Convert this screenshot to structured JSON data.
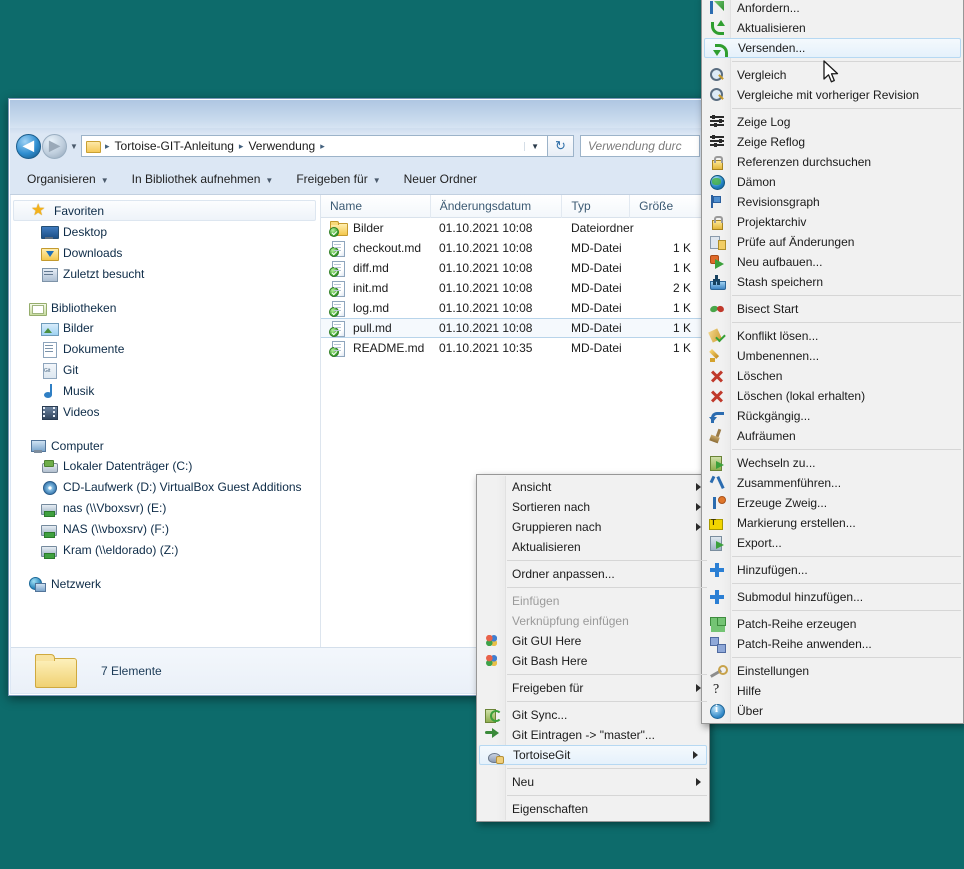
{
  "desktop": {
    "background_color": "#0d6b6b"
  },
  "explorer": {
    "address": {
      "breadcrumbs": [
        "Tortoise-GIT-Anleitung",
        "Verwendung"
      ],
      "separator": "▸",
      "back_label": "◀",
      "forward_label": "▶",
      "history_caret": "▼",
      "dropdown_caret": "▼",
      "refresh_label": "↻"
    },
    "search": {
      "placeholder": "Verwendung durc"
    },
    "toolbar": [
      {
        "label": "Organisieren",
        "has_caret": true
      },
      {
        "label": "In Bibliothek aufnehmen",
        "has_caret": true
      },
      {
        "label": "Freigeben für",
        "has_caret": true
      },
      {
        "label": "Neuer Ordner",
        "has_caret": false
      }
    ],
    "navpane": [
      {
        "label": "Favoriten",
        "icon": "star-icon",
        "type": "group",
        "selected": true
      },
      {
        "label": "Desktop",
        "icon": "desktop-icon",
        "type": "child"
      },
      {
        "label": "Downloads",
        "icon": "downloads-icon",
        "type": "child"
      },
      {
        "label": "Zuletzt besucht",
        "icon": "recent-icon",
        "type": "child"
      },
      {
        "label": "",
        "icon": "",
        "type": "spacer"
      },
      {
        "label": "Bibliotheken",
        "icon": "library-icon",
        "type": "group"
      },
      {
        "label": "Bilder",
        "icon": "pictures-icon",
        "type": "child"
      },
      {
        "label": "Dokumente",
        "icon": "documents-icon",
        "type": "child"
      },
      {
        "label": "Git",
        "icon": "git-library-icon",
        "type": "child"
      },
      {
        "label": "Musik",
        "icon": "music-icon",
        "type": "child"
      },
      {
        "label": "Videos",
        "icon": "video-icon",
        "type": "child"
      },
      {
        "label": "",
        "icon": "",
        "type": "spacer"
      },
      {
        "label": "Computer",
        "icon": "computer-icon",
        "type": "group"
      },
      {
        "label": "Lokaler Datenträger (C:)",
        "icon": "harddisk-icon",
        "type": "child"
      },
      {
        "label": "CD-Laufwerk (D:) VirtualBox Guest Additions",
        "icon": "cd-drive-icon",
        "type": "child"
      },
      {
        "label": "nas (\\\\Vboxsvr) (E:)",
        "icon": "network-drive-icon",
        "type": "child"
      },
      {
        "label": "NAS (\\\\vboxsrv) (F:)",
        "icon": "network-drive-icon",
        "type": "child"
      },
      {
        "label": "Kram (\\\\eldorado) (Z:)",
        "icon": "network-drive-icon",
        "type": "child"
      },
      {
        "label": "",
        "icon": "",
        "type": "spacer"
      },
      {
        "label": "Netzwerk",
        "icon": "network-icon",
        "type": "group"
      }
    ],
    "columns": [
      {
        "label": "Name",
        "sorted": true
      },
      {
        "label": "Änderungsdatum",
        "sorted": false
      },
      {
        "label": "Typ",
        "sorted": false
      },
      {
        "label": "Größe",
        "sorted": false
      }
    ],
    "files": [
      {
        "name": "Bilder",
        "date": "01.10.2021 10:08",
        "type": "Dateiordner",
        "size": "",
        "icon": "folder-git-icon",
        "selected": false
      },
      {
        "name": "checkout.md",
        "date": "01.10.2021 10:08",
        "type": "MD-Datei",
        "size": "1 K",
        "icon": "file-git-icon",
        "selected": false
      },
      {
        "name": "diff.md",
        "date": "01.10.2021 10:08",
        "type": "MD-Datei",
        "size": "1 K",
        "icon": "file-git-icon",
        "selected": false
      },
      {
        "name": "init.md",
        "date": "01.10.2021 10:08",
        "type": "MD-Datei",
        "size": "2 K",
        "icon": "file-git-icon",
        "selected": false
      },
      {
        "name": "log.md",
        "date": "01.10.2021 10:08",
        "type": "MD-Datei",
        "size": "1 K",
        "icon": "file-git-icon",
        "selected": false
      },
      {
        "name": "pull.md",
        "date": "01.10.2021 10:08",
        "type": "MD-Datei",
        "size": "1 K",
        "icon": "file-git-icon",
        "selected": true
      },
      {
        "name": "README.md",
        "date": "01.10.2021 10:35",
        "type": "MD-Datei",
        "size": "1 K",
        "icon": "file-git-icon",
        "selected": false
      }
    ],
    "statusbar": {
      "text": "7 Elemente"
    }
  },
  "context_menu": {
    "items": [
      {
        "label": "Ansicht",
        "icon": "",
        "submenu": true,
        "disabled": false,
        "sep_after": false
      },
      {
        "label": "Sortieren nach",
        "icon": "",
        "submenu": true,
        "disabled": false,
        "sep_after": false
      },
      {
        "label": "Gruppieren nach",
        "icon": "",
        "submenu": true,
        "disabled": false,
        "sep_after": false
      },
      {
        "label": "Aktualisieren",
        "icon": "",
        "submenu": false,
        "disabled": false,
        "sep_after": true
      },
      {
        "label": "Ordner anpassen...",
        "icon": "",
        "submenu": false,
        "disabled": false,
        "sep_after": true
      },
      {
        "label": "Einfügen",
        "icon": "",
        "submenu": false,
        "disabled": true,
        "sep_after": false
      },
      {
        "label": "Verknüpfung einfügen",
        "icon": "",
        "submenu": false,
        "disabled": true,
        "sep_after": false
      },
      {
        "label": "Git GUI Here",
        "icon": "git-diamond-icon",
        "submenu": false,
        "disabled": false,
        "sep_after": false
      },
      {
        "label": "Git Bash Here",
        "icon": "git-diamond-icon",
        "submenu": false,
        "disabled": false,
        "sep_after": true
      },
      {
        "label": "Freigeben für",
        "icon": "",
        "submenu": true,
        "disabled": false,
        "sep_after": true
      },
      {
        "label": "Git Sync...",
        "icon": "git-sync-icon",
        "submenu": false,
        "disabled": false,
        "sep_after": false
      },
      {
        "label": "Git Eintragen -> \"master\"...",
        "icon": "git-commit-icon",
        "submenu": false,
        "disabled": false,
        "sep_after": false
      },
      {
        "label": "TortoiseGit",
        "icon": "tortoisegit-icon",
        "submenu": true,
        "disabled": false,
        "sep_after": true,
        "highlighted": true
      },
      {
        "label": "Neu",
        "icon": "",
        "submenu": true,
        "disabled": false,
        "sep_after": true
      },
      {
        "label": "Eigenschaften",
        "icon": "",
        "submenu": false,
        "disabled": false,
        "sep_after": false
      }
    ]
  },
  "tortoisegit_menu": {
    "items": [
      {
        "label": "Anfordern...",
        "icon": "fetch-icon",
        "sep_after": false
      },
      {
        "label": "Aktualisieren",
        "icon": "pull-icon",
        "sep_after": false
      },
      {
        "label": "Versenden...",
        "icon": "push-icon",
        "sep_after": true,
        "highlighted": true
      },
      {
        "label": "Vergleich",
        "icon": "diff-icon",
        "sep_after": false
      },
      {
        "label": "Vergleiche mit vorheriger Revision",
        "icon": "diff-prev-icon",
        "sep_after": true
      },
      {
        "label": "Zeige Log",
        "icon": "log-icon",
        "sep_after": false
      },
      {
        "label": "Zeige Reflog",
        "icon": "reflog-icon",
        "sep_after": false
      },
      {
        "label": "Referenzen durchsuchen",
        "icon": "refbrowse-icon",
        "sep_after": false
      },
      {
        "label": "Dämon",
        "icon": "daemon-icon",
        "sep_after": false
      },
      {
        "label": "Revisionsgraph",
        "icon": "revgraph-icon",
        "sep_after": false
      },
      {
        "label": "Projektarchiv",
        "icon": "repobrowser-icon",
        "sep_after": false
      },
      {
        "label": "Prüfe auf Änderungen",
        "icon": "checkmods-icon",
        "sep_after": false
      },
      {
        "label": "Neu aufbauen...",
        "icon": "rebase-icon",
        "sep_after": false
      },
      {
        "label": "Stash speichern",
        "icon": "stash-icon",
        "sep_after": true
      },
      {
        "label": "Bisect Start",
        "icon": "bisect-icon",
        "sep_after": true
      },
      {
        "label": "Konflikt lösen...",
        "icon": "resolve-icon",
        "sep_after": false
      },
      {
        "label": "Umbenennen...",
        "icon": "rename-icon",
        "sep_after": false
      },
      {
        "label": "Löschen",
        "icon": "delete-icon",
        "sep_after": false
      },
      {
        "label": "Löschen (lokal erhalten)",
        "icon": "delete-keep-icon",
        "sep_after": false
      },
      {
        "label": "Rückgängig...",
        "icon": "revert-icon",
        "sep_after": false
      },
      {
        "label": "Aufräumen",
        "icon": "cleanup-icon",
        "sep_after": true
      },
      {
        "label": "Wechseln zu...",
        "icon": "switch-icon",
        "sep_after": false
      },
      {
        "label": "Zusammenführen...",
        "icon": "merge-icon",
        "sep_after": false
      },
      {
        "label": "Erzeuge Zweig...",
        "icon": "branch-icon",
        "sep_after": false
      },
      {
        "label": "Markierung erstellen...",
        "icon": "tag-icon",
        "sep_after": false
      },
      {
        "label": "Export...",
        "icon": "export-icon",
        "sep_after": true
      },
      {
        "label": "Hinzufügen...",
        "icon": "add-icon",
        "sep_after": true
      },
      {
        "label": "Submodul hinzufügen...",
        "icon": "add-submodule-icon",
        "sep_after": true
      },
      {
        "label": "Patch-Reihe erzeugen",
        "icon": "patch-create-icon",
        "sep_after": false
      },
      {
        "label": "Patch-Reihe anwenden...",
        "icon": "patch-apply-icon",
        "sep_after": true
      },
      {
        "label": "Einstellungen",
        "icon": "settings-icon",
        "sep_after": false
      },
      {
        "label": "Hilfe",
        "icon": "help-icon",
        "sep_after": false
      },
      {
        "label": "Über",
        "icon": "about-icon",
        "sep_after": false
      }
    ]
  }
}
